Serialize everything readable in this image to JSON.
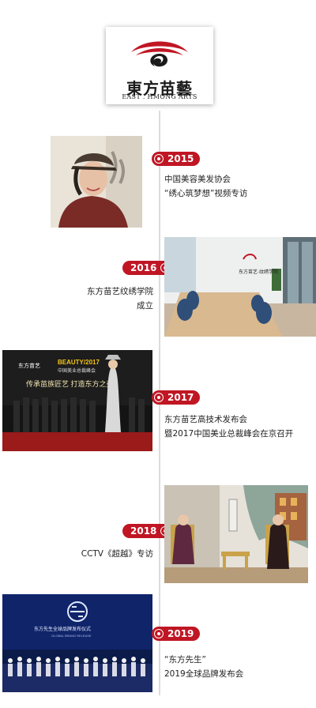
{
  "logo": {
    "name_cn": "東方苗藝",
    "name_en": "EAST . HMONG ARTS",
    "brand_colors": {
      "red": "#c01624",
      "black": "#1a1a1a"
    }
  },
  "timeline": [
    {
      "year": "2015",
      "lines": [
        "中国美容美发协会",
        "“绣心筑梦想”视频专访"
      ]
    },
    {
      "year": "2016",
      "lines": [
        "东方苗艺纹绣学院",
        "成立"
      ]
    },
    {
      "year": "2017",
      "lines": [
        "东方苗艺高技术发布会",
        "暨2017中国美业总裁峰会在京召开"
      ]
    },
    {
      "year": "2018",
      "lines": [
        "CCTV《超越》专访"
      ]
    },
    {
      "year": "2019",
      "lines": [
        "“东方先生”",
        "2019全球品牌发布会"
      ]
    }
  ],
  "photo_text": {
    "academy_sign": "东方苗艺·纹绣学院",
    "stage_banner_left": "东方苗艺",
    "stage_banner_beauty": "BEAUTY/2017",
    "stage_banner_sub": "中国美业总裁峰会",
    "stage_slogan": "传承苗族匠艺 打造东方之美",
    "launch_title": "东方先生全球品牌发布仪式",
    "launch_sub": "GLOBAL BRAND RELEASE"
  }
}
